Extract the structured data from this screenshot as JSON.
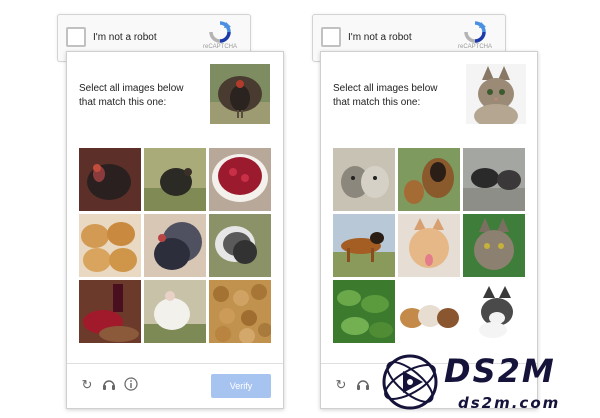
{
  "left_widget": {
    "anchor_label": "I'm not a robot",
    "recaptcha_label": "reCAPTCHA",
    "prompt": "Select all images below that match this one:",
    "sample_subject": "turkey",
    "tiles": [
      {
        "subject": "turkey"
      },
      {
        "subject": "turkey in field"
      },
      {
        "subject": "cranberry sauce"
      },
      {
        "subject": "bread rolls"
      },
      {
        "subject": "turkey"
      },
      {
        "subject": "turkey"
      },
      {
        "subject": "wine and cranberries"
      },
      {
        "subject": "white turkey"
      },
      {
        "subject": "walnuts"
      }
    ],
    "footer": {
      "reload_icon": "reload-icon",
      "audio_icon": "headphones-icon",
      "info_icon": "info-icon",
      "verify_label": "Verify"
    }
  },
  "right_widget": {
    "anchor_label": "I'm not a robot",
    "recaptcha_label": "reCAPTCHA",
    "prompt": "Select all images below that match this one:",
    "sample_subject": "tabby cat",
    "tiles": [
      {
        "subject": "cats"
      },
      {
        "subject": "dog and puppy"
      },
      {
        "subject": "dogs"
      },
      {
        "subject": "german shepherd"
      },
      {
        "subject": "kitten"
      },
      {
        "subject": "tabby cat"
      },
      {
        "subject": "plant leaves"
      },
      {
        "subject": "guinea pigs"
      },
      {
        "subject": "kitten"
      }
    ]
  },
  "watermark": {
    "brand": "DS2M",
    "url": "ds2m.com"
  },
  "colors": {
    "verify_disabled": "#a7c4f1",
    "recaptcha_blue": "#4a90e2",
    "recaptcha_gray": "#b4b4b4",
    "watermark_dark": "#15133a"
  }
}
